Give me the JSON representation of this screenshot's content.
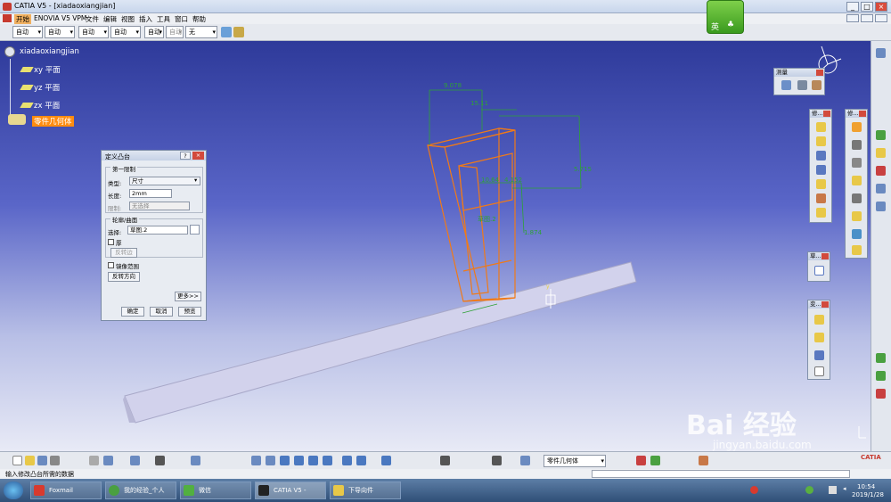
{
  "window": {
    "title": "CATIA V5 - [xiadaoxiangjian]",
    "min": "_",
    "max": "□",
    "close": "×"
  },
  "menu": [
    "开始",
    "ENOVIA V5 VPM",
    "文件",
    "编辑",
    "视图",
    "插入",
    "工具",
    "窗口",
    "帮助"
  ],
  "toolbar_row": {
    "combos": [
      "自动",
      "自动",
      "自动",
      "自动",
      "自动",
      "自动",
      "无"
    ]
  },
  "ime": {
    "label": "英"
  },
  "tree": {
    "root": "xiadaoxiangjian",
    "items": [
      "xy 平面",
      "yz 平面",
      "zx 平面"
    ],
    "body": "零件几何体"
  },
  "dimensions": [
    "9.078",
    "15.11",
    "5.715",
    "10.64",
    "4.152",
    "1.874",
    "草图.2"
  ],
  "measure_palette": {
    "title": "测量"
  },
  "palettes": {
    "p1": "修...",
    "p2": "修...",
    "p3": "草...",
    "p4": "变..."
  },
  "dialog": {
    "title": "定义凸台",
    "help": "?",
    "close": "×",
    "group1": "第一限制",
    "type_label": "类型:",
    "type_value": "尺寸",
    "length_label": "长度:",
    "length_value": "2mm",
    "limit_label": "限制:",
    "limit_value": "无选择",
    "group2": "轮廓/曲面",
    "select_label": "选择:",
    "select_value": "草图.2",
    "thick": "厚",
    "reverse_side": "反转边",
    "mirror": "镜像范围",
    "reverse_dir": "反转方向",
    "more": "更多>>",
    "ok": "确定",
    "cancel": "取消",
    "preview": "预览"
  },
  "bottom_combo": "零件几何体",
  "status": {
    "text": "输入修改凸台所需的数据"
  },
  "taskbar": {
    "items": [
      "Foxmail",
      "我的经验_个人中...",
      "微信",
      "CATIA V5 - [xiad...",
      "下导向件"
    ],
    "time": "10:54",
    "date": "2019/1/28"
  },
  "watermark": {
    "main": "Bai 经验",
    "url": "jingyan.baidu.com"
  },
  "colors": {
    "accent": "#f07a18",
    "dim": "#2ea236",
    "tree_bg": "#ff8a1e",
    "highlight_tree": "#ff8c10"
  }
}
